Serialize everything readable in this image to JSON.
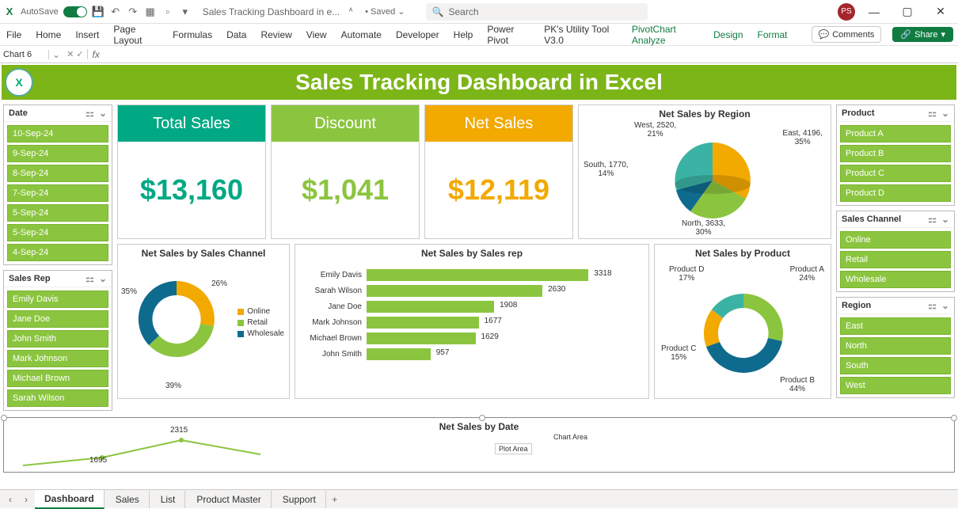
{
  "titlebar": {
    "autosave": "AutoSave",
    "doc_title": "Sales Tracking Dashboard in e...",
    "saved": "• Saved ⌄",
    "search_placeholder": "Search",
    "user_initials": "PS"
  },
  "ribbon": {
    "tabs": [
      "File",
      "Home",
      "Insert",
      "Page Layout",
      "Formulas",
      "Data",
      "Review",
      "View",
      "Automate",
      "Developer",
      "Help",
      "Power Pivot",
      "PK's Utility Tool V3.0"
    ],
    "ctx_tabs": [
      "PivotChart Analyze",
      "Design",
      "Format"
    ],
    "comments": "Comments",
    "share": "Share"
  },
  "formula": {
    "name_box": "Chart 6",
    "fx": "fx"
  },
  "dashboard": {
    "title": "Sales Tracking Dashboard in Excel",
    "slicers_left": {
      "date": {
        "label": "Date",
        "items": [
          "10-Sep-24",
          "9-Sep-24",
          "8-Sep-24",
          "7-Sep-24",
          "5-Sep-24",
          "5-Sep-24",
          "4-Sep-24"
        ]
      },
      "rep": {
        "label": "Sales Rep",
        "items": [
          "Emily Davis",
          "Jane Doe",
          "John Smith",
          "Mark Johnson",
          "Michael Brown",
          "Sarah Wilson"
        ]
      }
    },
    "slicers_right": {
      "product": {
        "label": "Product",
        "items": [
          "Product A",
          "Product B",
          "Product C",
          "Product D"
        ]
      },
      "channel": {
        "label": "Sales Channel",
        "items": [
          "Online",
          "Retail",
          "Wholesale"
        ]
      },
      "region": {
        "label": "Region",
        "items": [
          "East",
          "North",
          "South",
          "West"
        ]
      }
    },
    "kpis": {
      "total": {
        "label": "Total Sales",
        "value": "$13,160"
      },
      "discount": {
        "label": "Discount",
        "value": "$1,041"
      },
      "net": {
        "label": "Net Sales",
        "value": "$12,119"
      }
    },
    "region_chart_title": "Net Sales by Region",
    "channel_chart_title": "Net Sales by Sales Channel",
    "rep_chart_title": "Net Sales by Sales rep",
    "product_chart_title": "Net Sales by Product",
    "date_chart_title": "Net Sales  by Date",
    "channel_legend": [
      "Online",
      "Retail",
      "Wholesale"
    ],
    "plot_area_hint": "Plot Area",
    "chart_area_hint": "Chart Area",
    "date_labels": {
      "p1": "1695",
      "p2": "2315"
    }
  },
  "sheets": [
    "Dashboard",
    "Sales",
    "List",
    "Product Master",
    "Support"
  ],
  "chart_data": [
    {
      "type": "pie",
      "title": "Net Sales by Region",
      "series": [
        {
          "name": "Net Sales",
          "values": [
            4196,
            3633,
            1770,
            2520
          ]
        }
      ],
      "categories": [
        "East",
        "North",
        "South",
        "West"
      ],
      "percentages": [
        35,
        30,
        14,
        21
      ],
      "data_labels": [
        "East, 4196, 35%",
        "North, 3633, 30%",
        "South, 1770, 14%",
        "West, 2520, 21%"
      ]
    },
    {
      "type": "pie",
      "title": "Net Sales by Sales Channel",
      "categories": [
        "Online",
        "Retail",
        "Wholesale"
      ],
      "percentages": [
        26,
        39,
        35
      ],
      "legend_position": "right"
    },
    {
      "type": "bar",
      "title": "Net Sales by Sales rep",
      "categories": [
        "Emily Davis",
        "Sarah Wilson",
        "Jane Doe",
        "Mark Johnson",
        "Michael Brown",
        "John Smith"
      ],
      "values": [
        3318,
        2630,
        1908,
        1677,
        1629,
        957
      ],
      "xlabel": "",
      "ylabel": ""
    },
    {
      "type": "pie",
      "title": "Net Sales by Product",
      "categories": [
        "Product A",
        "Product B",
        "Product C",
        "Product D"
      ],
      "percentages": [
        24,
        44,
        15,
        17
      ]
    },
    {
      "type": "line",
      "title": "Net Sales by Date",
      "visible_points": [
        1695,
        2315
      ]
    }
  ]
}
